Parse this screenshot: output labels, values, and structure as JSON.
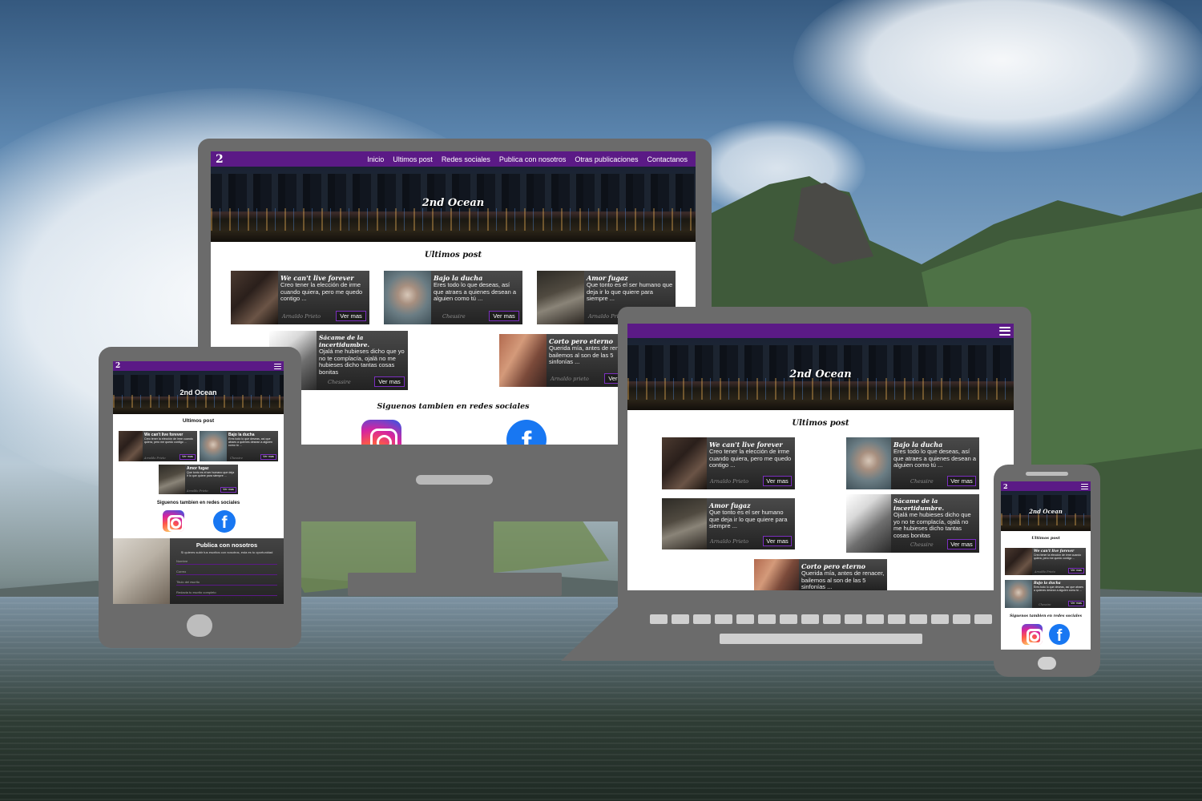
{
  "site": {
    "logo": "2",
    "nav_links": [
      "Inicio",
      "Ultimos post",
      "Redes sociales",
      "Publica con nosotros",
      "Otras publicaciones",
      "Contactanos"
    ],
    "hero_title": "2nd Ocean",
    "section_posts": "Ultimos post",
    "section_social": "Siguenos tambien en redes sociales",
    "fb_glyph": "f",
    "read_more": "Ver mas"
  },
  "posts": [
    {
      "title": "We can't live forever",
      "excerpt": "Creo tener la elección de irme cuando quiera, pero me quedo contigo ...",
      "author": "Arnaldo Prieto",
      "image": "hands-photo"
    },
    {
      "title": "Bajo la ducha",
      "excerpt": "Eres todo lo que deseas, así que atraes a quienes desean a alguien como tú ...",
      "author": "Chessire",
      "image": "woman-water-photo"
    },
    {
      "title": "Amor fugaz",
      "excerpt": "Que tonto es el ser humano que deja ir lo que quiere para siempre ...",
      "author": "Arnaldo Prieto",
      "image": "window-photo"
    },
    {
      "title": "Sácame de la incertidumbre.",
      "excerpt": "Ojalá me hubieses dicho que yo no te complacía, ojalá no me hubieses dicho tantas cosas bonitas",
      "author": "Chessire",
      "image": "blossom-window-photo"
    },
    {
      "title": "Corto pero eterno",
      "excerpt": "Querida mía, antes de renacer, bailemos al son de las 5 sinfonías ...",
      "author": "Arnaldo prieto",
      "image": "couple-photo"
    }
  ],
  "tablet_posts": [
    {
      "title": "We can't live forever",
      "excerpt": "Creo tener la elección de irme cuando quiera, pero me quedo contigo ...",
      "author": "Arnaldo Prieto"
    },
    {
      "title": "Bajo la ducha",
      "excerpt": "Eres todo lo que deseas, así que atraes a quienes desean a alguien como tú ...",
      "author": "Chessire"
    },
    {
      "title": "Amor fugaz",
      "excerpt": "Que tonto es el ser humano que deja ir lo que quiere para siempre ...",
      "author": "Arnaldo Prieto"
    }
  ],
  "publica": {
    "title": "Publica con nosotros",
    "subtitle": "Si quieres subir tus escritos con nosotros, esta es tu oportunidad",
    "fields": [
      "Nombre",
      "Correo",
      "Titulo del escrito",
      "Redacta tu escrito completo"
    ]
  },
  "colors": {
    "nav": "#5b1a86",
    "accent": "#7b2fbf",
    "device": "#6b6b6b"
  },
  "icons": [
    "instagram-icon",
    "facebook-icon",
    "hamburger-menu-icon"
  ]
}
